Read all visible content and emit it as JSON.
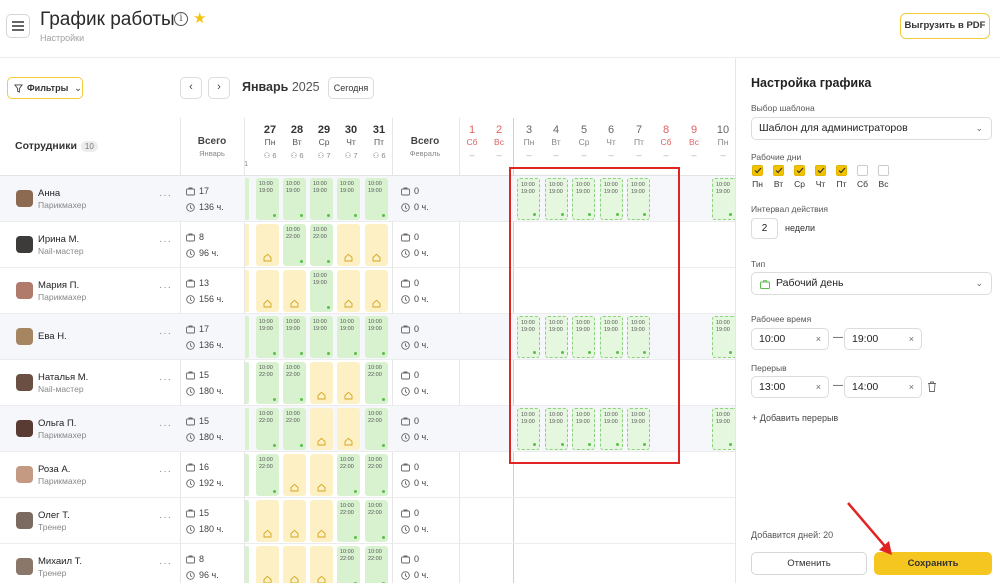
{
  "header": {
    "title": "График работы",
    "subtitle": "Настройки",
    "export_label": "Выгрузить в PDF"
  },
  "toolbar": {
    "filters_label": "Фильтры",
    "month": "Январь",
    "year": "2025",
    "today_label": "Сегодня"
  },
  "grid": {
    "employees_title": "Сотрудники",
    "employees_count": "10",
    "total_label": "Всего",
    "total_jan": "Январь",
    "total_feb": "Февраль",
    "jan_days": [
      {
        "num": "27",
        "name": "Пн",
        "count": "6"
      },
      {
        "num": "28",
        "name": "Вт",
        "count": "6"
      },
      {
        "num": "29",
        "name": "Ср",
        "count": "7"
      },
      {
        "num": "30",
        "name": "Чт",
        "count": "7"
      },
      {
        "num": "31",
        "name": "Пт",
        "count": "6"
      }
    ],
    "feb_days": [
      {
        "num": "1",
        "name": "Сб",
        "weekend": true
      },
      {
        "num": "2",
        "name": "Вс",
        "weekend": true
      },
      {
        "num": "3",
        "name": "Пн",
        "weekend": false
      },
      {
        "num": "4",
        "name": "Вт",
        "weekend": false
      },
      {
        "num": "5",
        "name": "Ср",
        "weekend": false
      },
      {
        "num": "6",
        "name": "Чт",
        "weekend": false
      },
      {
        "num": "7",
        "name": "Пт",
        "weekend": false
      },
      {
        "num": "8",
        "name": "Сб",
        "weekend": true
      },
      {
        "num": "9",
        "name": "Вс",
        "weekend": true
      },
      {
        "num": "10",
        "name": "Пн",
        "weekend": false
      }
    ],
    "partial_count": "1",
    "dash": "–",
    "employees": [
      {
        "name": "Анна",
        "role": "Парикмахер",
        "shifts": "17",
        "hours": "136 ч.",
        "feb_shifts": "0",
        "feb_hours": "0 ч."
      },
      {
        "name": "Ирина М.",
        "role": "Nail-мастер",
        "shifts": "8",
        "hours": "96 ч.",
        "feb_shifts": "0",
        "feb_hours": "0 ч."
      },
      {
        "name": "Мария П.",
        "role": "Парикмахер",
        "shifts": "13",
        "hours": "156 ч.",
        "feb_shifts": "0",
        "feb_hours": "0 ч."
      },
      {
        "name": "Ева Н.",
        "role": "",
        "shifts": "17",
        "hours": "136 ч.",
        "feb_shifts": "0",
        "feb_hours": "0 ч."
      },
      {
        "name": "Наталья М.",
        "role": "Nail-мастер",
        "shifts": "15",
        "hours": "180 ч.",
        "feb_shifts": "0",
        "feb_hours": "0 ч."
      },
      {
        "name": "Ольга П.",
        "role": "Парикмахер",
        "shifts": "15",
        "hours": "180 ч.",
        "feb_shifts": "0",
        "feb_hours": "0 ч."
      },
      {
        "name": "Роза А.",
        "role": "Парикмахер",
        "shifts": "16",
        "hours": "192 ч.",
        "feb_shifts": "0",
        "feb_hours": "0 ч."
      },
      {
        "name": "Олег Т.",
        "role": "Тренер",
        "shifts": "15",
        "hours": "180 ч.",
        "feb_shifts": "0",
        "feb_hours": "0 ч."
      },
      {
        "name": "Михаил Т.",
        "role": "Тренер",
        "shifts": "8",
        "hours": "96 ч.",
        "feb_shifts": "0",
        "feb_hours": "0 ч."
      }
    ],
    "shift_1019": {
      "start": "10:00",
      "end": "19:00"
    },
    "shift_1022": {
      "start": "10:00",
      "end": "22:00"
    }
  },
  "panel": {
    "title": "Настройка графика",
    "template_label": "Выбор шаблона",
    "template_value": "Шаблон для администраторов",
    "workdays_label": "Рабочие дни",
    "workdays": [
      {
        "name": "Пн",
        "checked": true
      },
      {
        "name": "Вт",
        "checked": true
      },
      {
        "name": "Ср",
        "checked": true
      },
      {
        "name": "Чт",
        "checked": true
      },
      {
        "name": "Пт",
        "checked": true
      },
      {
        "name": "Сб",
        "checked": false
      },
      {
        "name": "Вс",
        "checked": false
      }
    ],
    "interval_label": "Интервал действия",
    "interval_value": "2",
    "interval_unit": "недели",
    "type_label": "Тип",
    "type_value": "Рабочий день",
    "work_time_label": "Рабочее время",
    "work_start": "10:00",
    "work_end": "19:00",
    "break_label": "Перерыв",
    "break_start": "13:00",
    "break_end": "14:00",
    "add_break_label": "Добавить перерыв",
    "days_added": "Добавится дней: 20",
    "cancel_label": "Отменить",
    "save_label": "Сохранить"
  },
  "colors": {
    "accent": "#f5c620",
    "shift_green": "#d8f2d0",
    "day_off_yellow": "#fdf0c4",
    "annotation_red": "#e02424"
  }
}
